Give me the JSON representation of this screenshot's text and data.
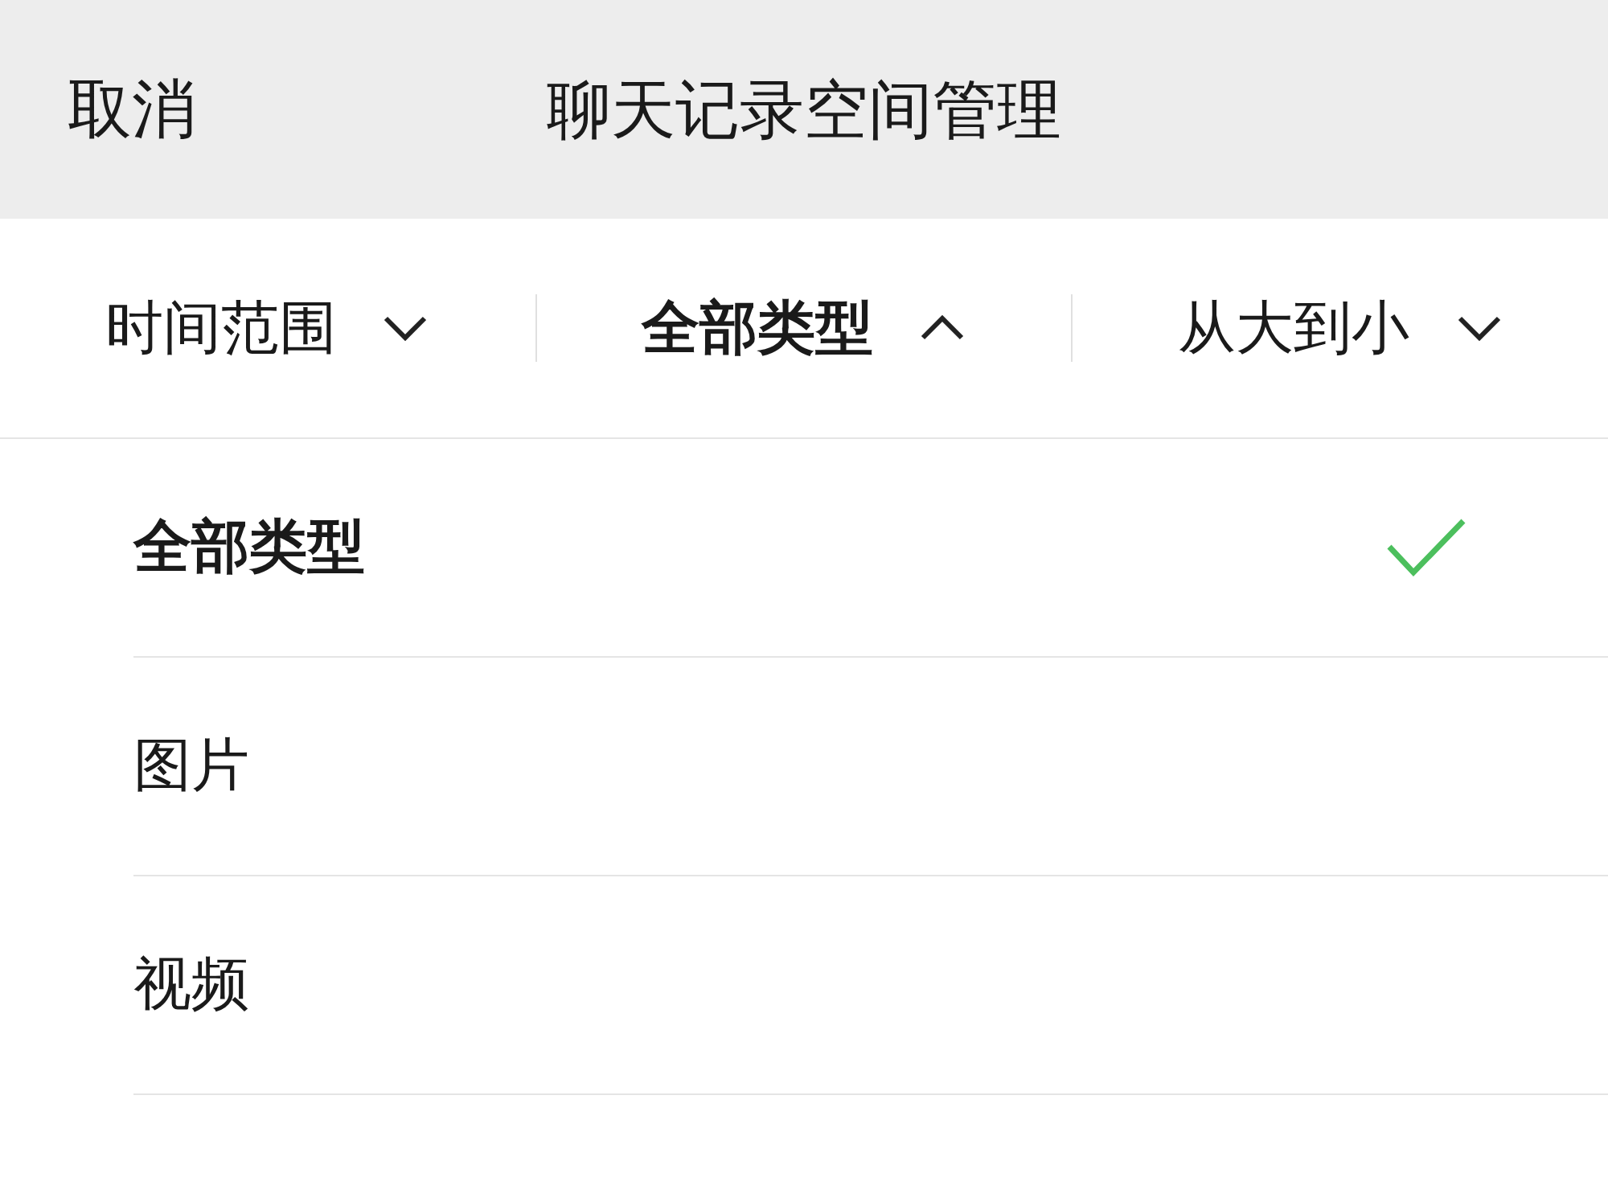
{
  "header": {
    "cancel": "取消",
    "title": "聊天记录空间管理"
  },
  "filters": [
    {
      "label": "时间范围",
      "expanded": false
    },
    {
      "label": "全部类型",
      "expanded": true
    },
    {
      "label": "从大到小",
      "expanded": false
    }
  ],
  "options": [
    {
      "label": "全部类型",
      "selected": true
    },
    {
      "label": "图片",
      "selected": false
    },
    {
      "label": "视频",
      "selected": false
    }
  ]
}
